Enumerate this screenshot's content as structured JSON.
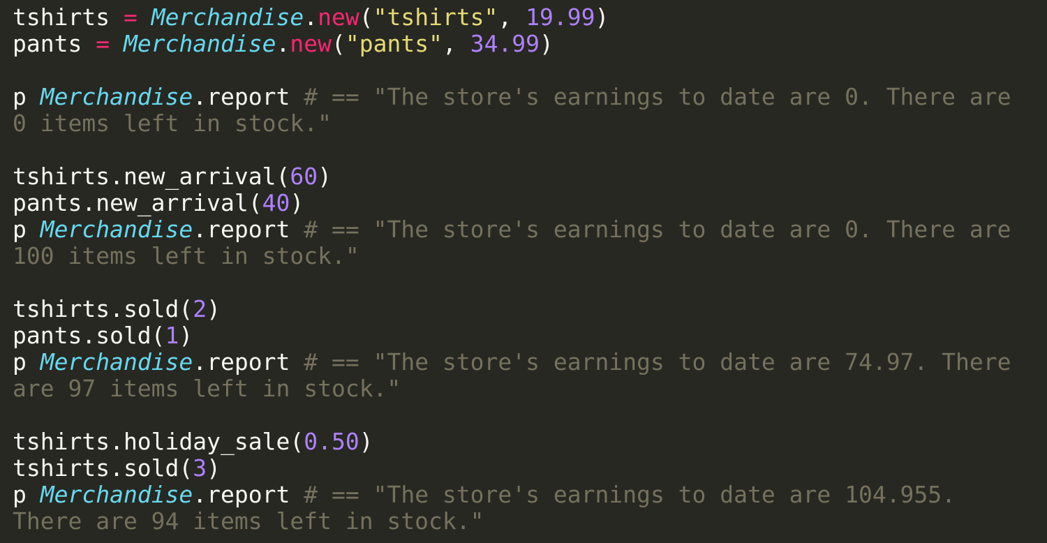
{
  "editor": {
    "language": "ruby",
    "theme": "Monokai",
    "colors": {
      "background": "#272822",
      "plain": "#f8f8f2",
      "operator": "#f92672",
      "class": "#66d9ef",
      "string": "#e6db74",
      "number": "#ae81ff",
      "comment": "#75715e"
    },
    "lines": [
      [
        {
          "t": "plain",
          "s": "tshirts "
        },
        {
          "t": "operator",
          "s": "="
        },
        {
          "t": "plain",
          "s": " "
        },
        {
          "t": "class",
          "s": "Merchandise"
        },
        {
          "t": "plain",
          "s": "."
        },
        {
          "t": "operator",
          "s": "new"
        },
        {
          "t": "plain",
          "s": "("
        },
        {
          "t": "string",
          "s": "\"tshirts\""
        },
        {
          "t": "plain",
          "s": ", "
        },
        {
          "t": "number",
          "s": "19.99"
        },
        {
          "t": "plain",
          "s": ")"
        }
      ],
      [
        {
          "t": "plain",
          "s": "pants "
        },
        {
          "t": "operator",
          "s": "="
        },
        {
          "t": "plain",
          "s": " "
        },
        {
          "t": "class",
          "s": "Merchandise"
        },
        {
          "t": "plain",
          "s": "."
        },
        {
          "t": "operator",
          "s": "new"
        },
        {
          "t": "plain",
          "s": "("
        },
        {
          "t": "string",
          "s": "\"pants\""
        },
        {
          "t": "plain",
          "s": ", "
        },
        {
          "t": "number",
          "s": "34.99"
        },
        {
          "t": "plain",
          "s": ")"
        }
      ],
      [],
      [
        {
          "t": "plain",
          "s": "p "
        },
        {
          "t": "class",
          "s": "Merchandise"
        },
        {
          "t": "plain",
          "s": ".report "
        },
        {
          "t": "comment",
          "s": "# == \"The store's earnings to date are 0. There are"
        }
      ],
      [
        {
          "t": "comment",
          "s": "0 items left in stock.\""
        }
      ],
      [],
      [
        {
          "t": "plain",
          "s": "tshirts.new_arrival("
        },
        {
          "t": "number",
          "s": "60"
        },
        {
          "t": "plain",
          "s": ")"
        }
      ],
      [
        {
          "t": "plain",
          "s": "pants.new_arrival("
        },
        {
          "t": "number",
          "s": "40"
        },
        {
          "t": "plain",
          "s": ")"
        }
      ],
      [
        {
          "t": "plain",
          "s": "p "
        },
        {
          "t": "class",
          "s": "Merchandise"
        },
        {
          "t": "plain",
          "s": ".report "
        },
        {
          "t": "comment",
          "s": "# == \"The store's earnings to date are 0. There are"
        }
      ],
      [
        {
          "t": "comment",
          "s": "100 items left in stock.\""
        }
      ],
      [],
      [
        {
          "t": "plain",
          "s": "tshirts.sold("
        },
        {
          "t": "number",
          "s": "2"
        },
        {
          "t": "plain",
          "s": ")"
        }
      ],
      [
        {
          "t": "plain",
          "s": "pants.sold("
        },
        {
          "t": "number",
          "s": "1"
        },
        {
          "t": "plain",
          "s": ")"
        }
      ],
      [
        {
          "t": "plain",
          "s": "p "
        },
        {
          "t": "class",
          "s": "Merchandise"
        },
        {
          "t": "plain",
          "s": ".report "
        },
        {
          "t": "comment",
          "s": "# == \"The store's earnings to date are 74.97. There"
        }
      ],
      [
        {
          "t": "comment",
          "s": "are 97 items left in stock.\""
        }
      ],
      [],
      [
        {
          "t": "plain",
          "s": "tshirts.holiday_sale("
        },
        {
          "t": "number",
          "s": "0.50"
        },
        {
          "t": "plain",
          "s": ")"
        }
      ],
      [
        {
          "t": "plain",
          "s": "tshirts.sold("
        },
        {
          "t": "number",
          "s": "3"
        },
        {
          "t": "plain",
          "s": ")"
        }
      ],
      [
        {
          "t": "plain",
          "s": "p "
        },
        {
          "t": "class",
          "s": "Merchandise"
        },
        {
          "t": "plain",
          "s": ".report "
        },
        {
          "t": "comment",
          "s": "# == \"The store's earnings to date are 104.955."
        }
      ],
      [
        {
          "t": "comment",
          "s": "There are 94 items left in stock.\""
        }
      ]
    ]
  }
}
